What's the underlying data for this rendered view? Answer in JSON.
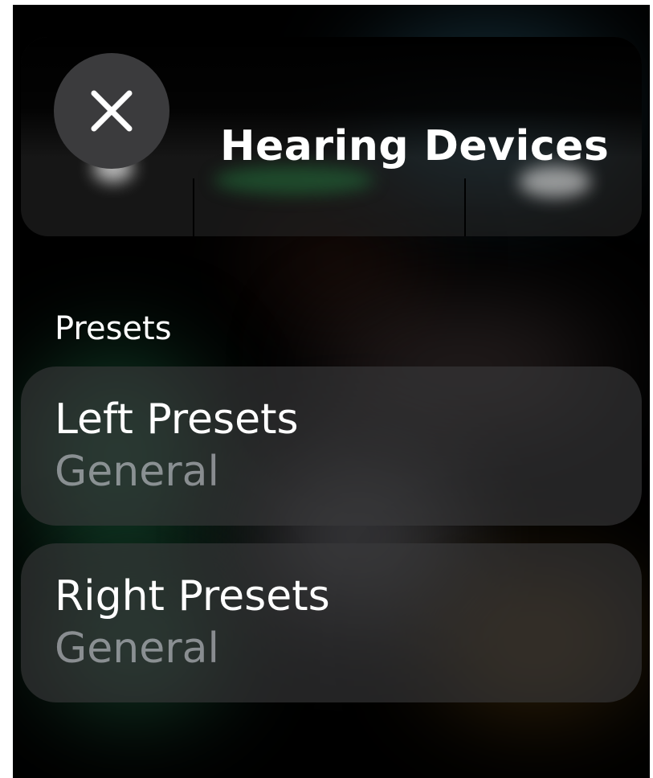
{
  "header": {
    "title": "Hearing Devices",
    "close_icon": "close-icon"
  },
  "presets": {
    "section_label": "Presets",
    "items": [
      {
        "label": "Left Presets",
        "value": "General"
      },
      {
        "label": "Right Presets",
        "value": "General"
      }
    ]
  },
  "colors": {
    "background": "#000000",
    "primary_text": "#ffffff",
    "secondary_text": "#8e8e93",
    "row_background": "#3a3a3c"
  }
}
